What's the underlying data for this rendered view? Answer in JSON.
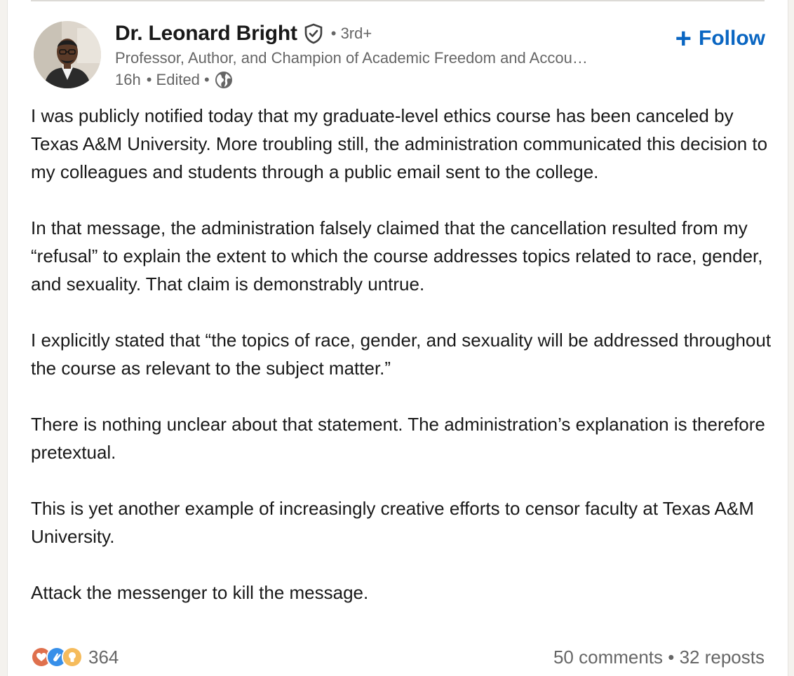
{
  "author": {
    "name": "Dr. Leonard Bright",
    "degree": "• 3rd+",
    "headline": "Professor, Author, and Champion of Academic Freedom and Accou…",
    "time": "16h",
    "edited": "• Edited •"
  },
  "follow": {
    "plus": "+",
    "label": "Follow"
  },
  "post": {
    "paragraphs": [
      "I was publicly notified today that my graduate-level ethics course has been canceled by Texas A&M University. More troubling still, the administration communicated this decision to my colleagues and students through a public email sent to the college.",
      "In that message, the administration falsely claimed that the cancellation resulted from my “refusal” to explain the extent to which the course addresses topics related to race, gender, and sexuality. That claim is demonstrably untrue.",
      "I explicitly stated that “the topics of race, gender, and sexuality will be addressed throughout the course as relevant to the subject matter.”",
      "There is nothing unclear about that statement. The administration’s explanation is therefore pretextual.",
      "This is yet another example of increasingly creative efforts to censor faculty at Texas A&M University.",
      "Attack the messenger to kill the message."
    ]
  },
  "footer": {
    "reaction_icons": [
      "heart-icon",
      "clap-icon",
      "insightful-icon"
    ],
    "reaction_count": "364",
    "stats": "50 comments • 32 reposts"
  },
  "colors": {
    "accent": "#0a66c2",
    "text_primary": "#191919",
    "text_secondary": "#666666"
  }
}
